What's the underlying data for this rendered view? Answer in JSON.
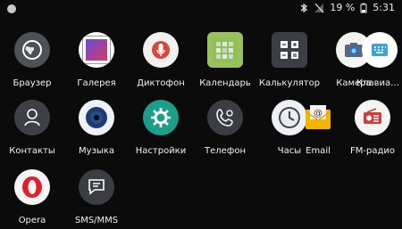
{
  "status": {
    "battery_percent": "19 %",
    "time": "5:31"
  },
  "apps": [
    {
      "label": "Браузер",
      "icon": "globe-icon"
    },
    {
      "label": "Галерея",
      "icon": "gallery-icon"
    },
    {
      "label": "Диктофон",
      "icon": "microphone-icon"
    },
    {
      "label": "Календарь",
      "icon": "calendar-icon"
    },
    {
      "label": "Калькулятор",
      "icon": "calculator-icon"
    },
    {
      "label": "Камера",
      "icon": "camera-icon"
    },
    {
      "label": "Клавиатура...",
      "icon": "keyboard-icon"
    },
    {
      "label": "Контакты",
      "icon": "contacts-icon"
    },
    {
      "label": "Музыка",
      "icon": "music-icon"
    },
    {
      "label": "Настройки",
      "icon": "settings-icon"
    },
    {
      "label": "Телефон",
      "icon": "phone-icon"
    },
    {
      "label": "Часы",
      "icon": "clock-icon"
    },
    {
      "label": "Email",
      "icon": "email-icon"
    },
    {
      "label": "FM-радио",
      "icon": "radio-icon"
    },
    {
      "label": "Opera",
      "icon": "opera-icon"
    },
    {
      "label": "SMS/MMS",
      "icon": "sms-icon"
    }
  ]
}
